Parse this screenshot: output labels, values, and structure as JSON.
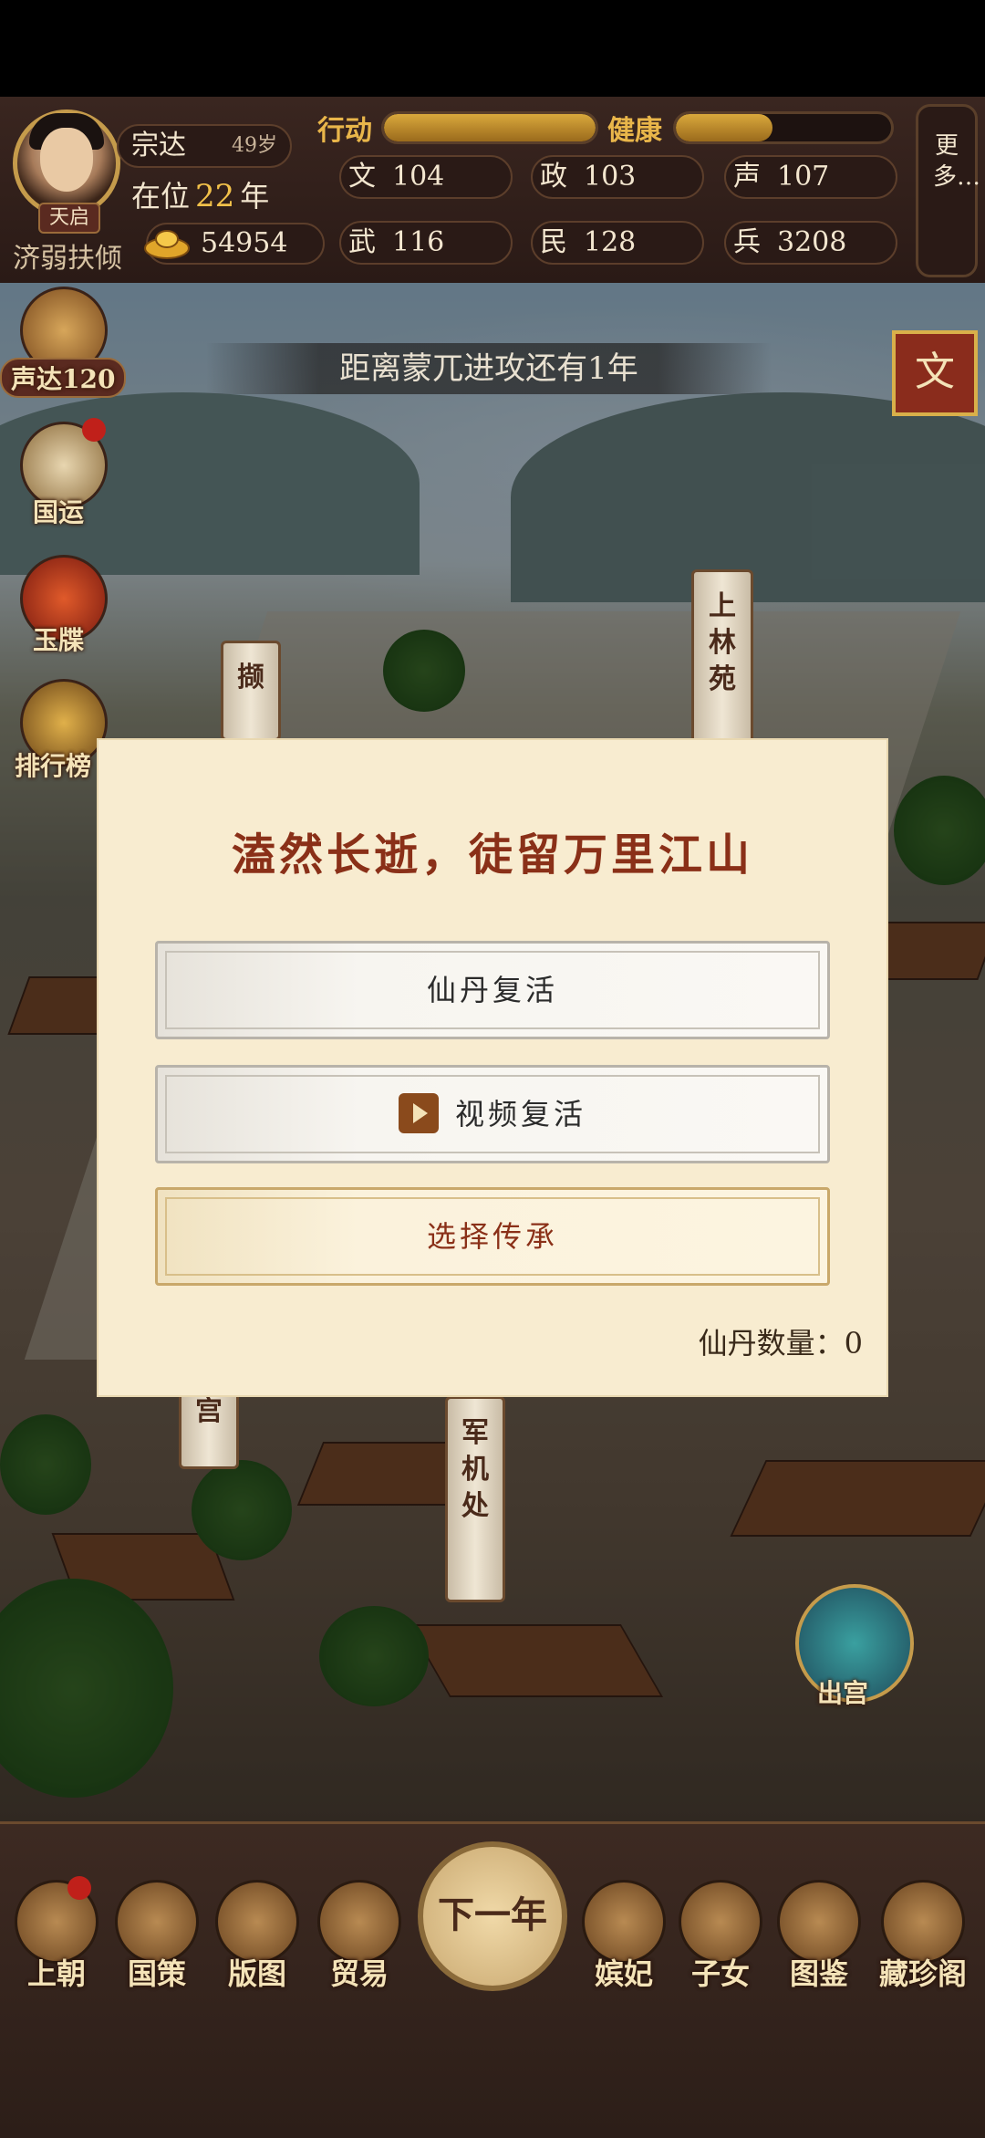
{
  "player": {
    "name": "宗达",
    "age": "49岁",
    "reign_prefix": "在位",
    "reign_years": "22",
    "reign_suffix": "年",
    "era_name": "天启",
    "title": "济弱扶倾",
    "gold": "54954"
  },
  "bars": {
    "action_label": "行动",
    "action_level": 1.0,
    "health_label": "健康",
    "health_level": 0.45
  },
  "stats": [
    {
      "key": "文",
      "value": "104"
    },
    {
      "key": "政",
      "value": "103"
    },
    {
      "key": "声",
      "value": "107"
    },
    {
      "key": "武",
      "value": "116"
    },
    {
      "key": "民",
      "value": "128"
    },
    {
      "key": "兵",
      "value": "3208"
    }
  ],
  "more_label": "更多…",
  "side": {
    "sheng_label": "声达120",
    "guoyun_label": "国运",
    "yudie_label": "玉牒",
    "paihang_label": "排行榜"
  },
  "countdown": "距离蒙兀进攻还有1年",
  "wen_button": "文",
  "banners": {
    "shanglinyuan": "上林苑",
    "left_top": "撷",
    "left_bottom": "宫",
    "junjichu": "军机处"
  },
  "dialog": {
    "title": "溘然长逝，徒留万里江山",
    "option_pill": "仙丹复活",
    "option_video": "视频复活",
    "option_inherit": "选择传承",
    "pill_count": "仙丹数量：0"
  },
  "chugong_label": "出宫",
  "nav": {
    "shangchao": "上朝",
    "guoce": "国策",
    "bantu": "版图",
    "maoyi": "贸易",
    "next_year": "下一年",
    "pinfei": "嫔妃",
    "zinv": "子女",
    "tujian": "图鉴",
    "cangzhen": "藏珍阁"
  },
  "colors": {
    "accent_gold": "#e9b64a",
    "dialog_bg": "#f8ecd0",
    "title_red": "#8a3018"
  }
}
